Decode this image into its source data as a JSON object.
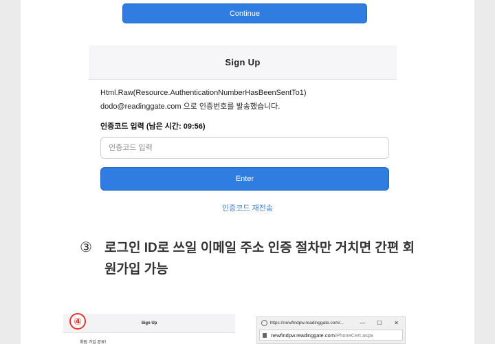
{
  "top": {
    "continue_label": "Continue"
  },
  "signup": {
    "title": "Sign Up",
    "message_line1": "Html.Raw(Resource.AuthenticationNumberHasBeenSentTo1)",
    "message_line2": "dodo@readinggate.com 으로 인증번호를 발송했습니다.",
    "code_label": "인증코드 입력 (남은 시간: 09:56)",
    "code_placeholder": "인증코드 입력",
    "enter_label": "Enter",
    "resend_link": "인증코드 재전송"
  },
  "step3": {
    "number": "③",
    "text": "로그인 ID로 쓰일 이메일 주소 인증 절차만 거치면 간편 회원가입 가능"
  },
  "bottom_left": {
    "badge": "④",
    "title": "Sign Up",
    "done_text": "회원 가입 완료!"
  },
  "bottom_right": {
    "window_title": "https://newfindpw.readinggate.com/...",
    "minimize": "—",
    "maximize": "☐",
    "close": "✕",
    "address_domain": "newfindpw.readinggate.com",
    "address_path": "/PhoneCert.aspx"
  },
  "colors": {
    "accent": "#2f7de1",
    "link": "#3b82d6",
    "badge": "#e53325",
    "outer_bg": "#ebebeb"
  }
}
